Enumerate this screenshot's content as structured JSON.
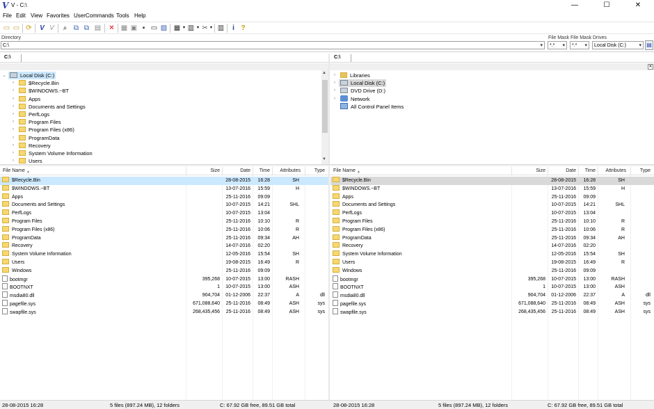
{
  "window": {
    "title": "V - C:\\",
    "minimize": "—",
    "maximize": "☐",
    "close": "✕"
  },
  "menu": [
    "File",
    "Edit",
    "View",
    "Favorites",
    "UserCommands",
    "Tools",
    "Help"
  ],
  "directory": {
    "label": "Directory",
    "value": "C:\\",
    "filemask_label1": "File Mask",
    "filemask_value1": "*.*",
    "filemask_label2": "File Mask",
    "filemask_value2": "*.*",
    "drives_label": "Drives",
    "drives_value": "Local Disk (C:)"
  },
  "left": {
    "path": "C:\\",
    "tree": [
      {
        "label": "Local Disk (C:)",
        "type": "drive"
      },
      {
        "label": "$Recycle.Bin",
        "type": "folder"
      },
      {
        "label": "$WINDOWS.~BT",
        "type": "folder"
      },
      {
        "label": "Apps",
        "type": "folder"
      },
      {
        "label": "Documents and Settings",
        "type": "link"
      },
      {
        "label": "PerfLogs",
        "type": "folder"
      },
      {
        "label": "Program Files",
        "type": "folder"
      },
      {
        "label": "Program Files (x86)",
        "type": "folder"
      },
      {
        "label": "ProgramData",
        "type": "folder"
      },
      {
        "label": "Recovery",
        "type": "folder"
      },
      {
        "label": "System Volume Information",
        "type": "folder"
      },
      {
        "label": "Users",
        "type": "folder"
      }
    ]
  },
  "right": {
    "path": "C:\\",
    "tree": [
      {
        "label": "Libraries",
        "type": "lib"
      },
      {
        "label": "Local Disk (C:)",
        "type": "drive"
      },
      {
        "label": "DVD Drive (D:)",
        "type": "drive"
      },
      {
        "label": "Network",
        "type": "net"
      },
      {
        "label": "All Control Panel Items",
        "type": "cpl"
      }
    ]
  },
  "columns": {
    "name": "File Name",
    "sort": "▲",
    "size": "Size",
    "date": "Date",
    "time": "Time",
    "attr": "Attributes",
    "type": "Type"
  },
  "files": [
    {
      "name": "$Recycle.Bin",
      "size": "",
      "date": "28-08-2015",
      "time": "16:28",
      "attr": "SH",
      "type": "",
      "kind": "folder"
    },
    {
      "name": "$WINDOWS.~BT",
      "size": "",
      "date": "13-07-2016",
      "time": "15:59",
      "attr": "H",
      "type": "",
      "kind": "folder"
    },
    {
      "name": "Apps",
      "size": "",
      "date": "25-11-2016",
      "time": "09:09",
      "attr": "",
      "type": "",
      "kind": "folder"
    },
    {
      "name": "Documents and Settings",
      "size": "",
      "date": "10-07-2015",
      "time": "14:21",
      "attr": "SHL",
      "type": "",
      "kind": "link"
    },
    {
      "name": "PerfLogs",
      "size": "",
      "date": "10-07-2015",
      "time": "13:04",
      "attr": "",
      "type": "",
      "kind": "folder"
    },
    {
      "name": "Program Files",
      "size": "",
      "date": "25-11-2016",
      "time": "10:10",
      "attr": "R",
      "type": "",
      "kind": "folder"
    },
    {
      "name": "Program Files (x86)",
      "size": "",
      "date": "25-11-2016",
      "time": "10:06",
      "attr": "R",
      "type": "",
      "kind": "folder"
    },
    {
      "name": "ProgramData",
      "size": "",
      "date": "25-11-2016",
      "time": "09:34",
      "attr": "AH",
      "type": "",
      "kind": "folder"
    },
    {
      "name": "Recovery",
      "size": "",
      "date": "14-07-2016",
      "time": "02:20",
      "attr": "",
      "type": "",
      "kind": "folder"
    },
    {
      "name": "System Volume Information",
      "size": "",
      "date": "12-05-2016",
      "time": "15:54",
      "attr": "SH",
      "type": "",
      "kind": "folder"
    },
    {
      "name": "Users",
      "size": "",
      "date": "19-08-2015",
      "time": "16:49",
      "attr": "R",
      "type": "",
      "kind": "folder"
    },
    {
      "name": "Windows",
      "size": "",
      "date": "25-11-2016",
      "time": "09:09",
      "attr": "",
      "type": "",
      "kind": "folder"
    },
    {
      "name": "bootmgr",
      "size": "395,268",
      "date": "10-07-2015",
      "time": "13:00",
      "attr": "RASH",
      "type": "",
      "kind": "file"
    },
    {
      "name": "BOOTNXT",
      "size": "1",
      "date": "10-07-2015",
      "time": "13:00",
      "attr": "ASH",
      "type": "",
      "kind": "file"
    },
    {
      "name": "msdia80.dll",
      "size": "904,704",
      "date": "01-12-2006",
      "time": "22:37",
      "attr": "A",
      "type": "dll",
      "kind": "file"
    },
    {
      "name": "pagefile.sys",
      "size": "671,088,640",
      "date": "25-11-2016",
      "time": "08:49",
      "attr": "ASH",
      "type": "sys",
      "kind": "file"
    },
    {
      "name": "swapfile.sys",
      "size": "268,435,456",
      "date": "25-11-2016",
      "time": "08:49",
      "attr": "ASH",
      "type": "sys",
      "kind": "file"
    }
  ],
  "status": {
    "left_date": "28-08-2015 16:28",
    "left_count": "5 files (897.24 MB), 12 folders",
    "left_free": "C: 67.92 GB free, 89.51 GB total",
    "right_date": "28-08-2015 16:28",
    "right_count": "5 files (897.24 MB), 12 folders",
    "right_free": "C: 67.92 GB free, 89.51 GB total"
  },
  "colors": {
    "selection": "#cce8ff",
    "inactive_selection": "#d9d9d9",
    "folder": "#f6d870"
  }
}
